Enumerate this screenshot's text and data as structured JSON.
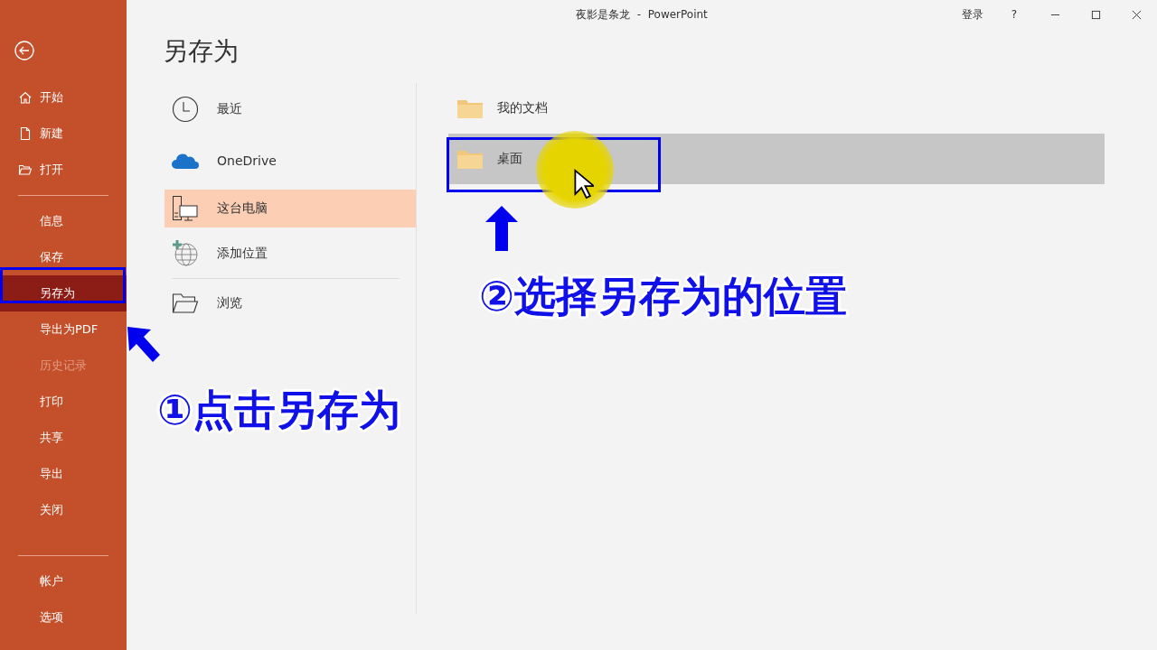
{
  "window": {
    "title": "夜影是条龙  -  PowerPoint",
    "sign_in": "登录",
    "help": "?"
  },
  "sidebar": {
    "top": [
      {
        "kind": "home",
        "label": "开始",
        "selected": false,
        "disabled": false
      },
      {
        "kind": "document",
        "label": "新建",
        "selected": false,
        "disabled": false
      },
      {
        "kind": "folder",
        "label": "打开",
        "selected": false,
        "disabled": false
      }
    ],
    "middle": [
      {
        "label": "信息",
        "selected": false,
        "disabled": false
      },
      {
        "label": "保存",
        "selected": false,
        "disabled": false
      },
      {
        "label": "另存为",
        "selected": true,
        "disabled": false
      },
      {
        "label": "导出为PDF",
        "selected": false,
        "disabled": false
      },
      {
        "label": "历史记录",
        "selected": false,
        "disabled": true
      },
      {
        "label": "打印",
        "selected": false,
        "disabled": false
      },
      {
        "label": "共享",
        "selected": false,
        "disabled": false
      },
      {
        "label": "导出",
        "selected": false,
        "disabled": false
      },
      {
        "label": "关闭",
        "selected": false,
        "disabled": false
      }
    ],
    "bottom": [
      {
        "label": "帐户",
        "selected": false,
        "disabled": false
      },
      {
        "label": "选项",
        "selected": false,
        "disabled": false
      }
    ]
  },
  "heading": "另存为",
  "places": [
    {
      "kind": "clock",
      "label": "最近",
      "selected": false
    },
    {
      "kind": "cloud",
      "label": "OneDrive",
      "selected": false
    },
    {
      "kind": "computer",
      "label": "这台电脑",
      "selected": true
    },
    {
      "kind": "globe",
      "label": "添加位置",
      "selected": false
    },
    {
      "kind": "browse",
      "label": "浏览",
      "selected": false
    }
  ],
  "folders": [
    {
      "label": "我的文档",
      "selected": false
    },
    {
      "label": "桌面",
      "selected": true
    }
  ],
  "annotations": [
    "①点击另存为",
    "②选择另存为的位置"
  ]
}
